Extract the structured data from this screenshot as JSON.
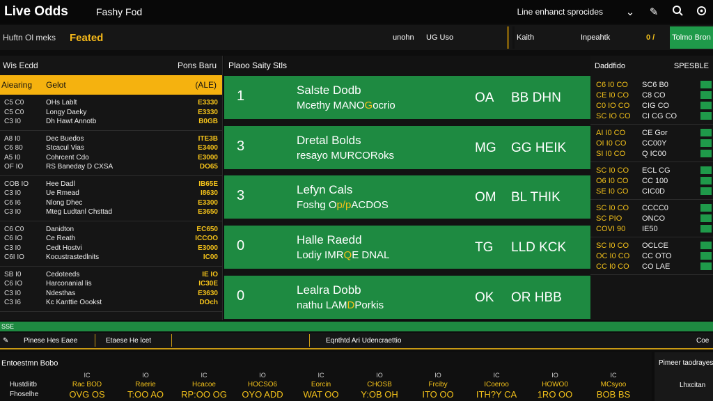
{
  "header": {
    "brand": "Live Odds",
    "subtitle": "Fashy Fod",
    "link": "Line enhanct sprocides",
    "icons": [
      "chevron-down-icon",
      "edit-icon",
      "search-icon",
      "globe-icon"
    ]
  },
  "subbar": {
    "label": "Huftn Ol meks",
    "accent": "Feated",
    "tabs": [
      "unohn",
      "UG Uso",
      "Kaith",
      "Inpeahtk"
    ],
    "badge": "0 /",
    "green_tab": "Tolmo Bron"
  },
  "left_panel": {
    "title": "Wis Ecdd",
    "title_right": "Pons Baru",
    "selected": {
      "col1": "Aiearing",
      "col2": "Gelot",
      "col3": "(ALE)"
    },
    "groups": [
      [
        {
          "time": "C5 C0",
          "name": "OHs Lablt",
          "odds": "E3330"
        },
        {
          "time": "C5 C0",
          "name": "Longy Daeky",
          "odds": "E3330"
        },
        {
          "time": "C3 I0",
          "name": "Dh Hawt Annotb",
          "odds": "B0GB"
        }
      ],
      [
        {
          "time": "A8 I0",
          "name": "Dec Buedos",
          "odds": "ITE3B"
        },
        {
          "time": "C6 80",
          "name": "Stcacul Vias",
          "odds": "E3400"
        },
        {
          "time": "A5 I0",
          "name": "Cohrcent Cdo",
          "odds": "E3000"
        },
        {
          "time": "OF IO",
          "name": "RS Baneday D CXSA",
          "odds": "DO65"
        }
      ],
      [
        {
          "time": "COB IO",
          "name": "Hee Dadl",
          "odds": "IB65E"
        },
        {
          "time": "C3 I0",
          "name": "Ue Rmead",
          "odds": "I8630"
        },
        {
          "time": "C6 I6",
          "name": "Nlong Dhec",
          "odds": "E3300"
        },
        {
          "time": "C3 I0",
          "name": "Mteg Ludtanl Chsttad",
          "odds": "E3650"
        }
      ],
      [
        {
          "time": "C6 C0",
          "name": "Danidton",
          "odds": "EC650"
        },
        {
          "time": "C6 IO",
          "name": "Ce Reath",
          "odds": "ICCOO"
        },
        {
          "time": "C3 I0",
          "name": "Cedt Hostvi",
          "odds": "E3000"
        },
        {
          "time": "C6I IO",
          "name": "Kocustrastedlnits",
          "odds": "IC00"
        }
      ],
      [
        {
          "time": "SB I0",
          "name": "Cedoteeds",
          "odds": "IE IO"
        },
        {
          "time": "C6 IO",
          "name": "Harconanial lis",
          "odds": "IC30E"
        },
        {
          "time": "C3 I0",
          "name": "Ndesthas",
          "odds": "E3630"
        },
        {
          "time": "C3 I6",
          "name": "Kc Kanttie Oookst",
          "odds": "DOch"
        }
      ]
    ]
  },
  "center_panel": {
    "title": "Plaoo Saity Stls",
    "cards": [
      {
        "num": "1",
        "title": "Salste Dodb",
        "sub_pre": "Mcethy MANO",
        "sub_hl": "G",
        "sub_post": "ocrio",
        "code": "OA",
        "code2": "BB DHN"
      },
      {
        "num": "3",
        "title": "Dretal Bolds",
        "sub_pre": "resayo MURCOR",
        "sub_hl": "",
        "sub_post": "oks",
        "code": "MG",
        "code2": "GG HEIK"
      },
      {
        "num": "3",
        "title": "Lefyn Cals",
        "sub_pre": "Foshg O",
        "sub_hl": "p/p",
        "sub_post": "ACDOS",
        "code": "OM",
        "code2": "BL THIK"
      },
      {
        "num": "0",
        "title": "Halle Raedd",
        "sub_pre": "Lodiy IMR",
        "sub_hl": "Q",
        "sub_post": "E DNAL",
        "code": "TG",
        "code2": "LLD KCK"
      },
      {
        "num": "0",
        "title": "Lealra Dobb",
        "sub_pre": "nathu LAM",
        "sub_hl": "D",
        "sub_post": "Porkis",
        "code": "OK",
        "code2": "OR HBB"
      }
    ]
  },
  "right_panel": {
    "title": "Daddfido",
    "title_right": "SPESBLE",
    "groups": [
      [
        {
          "a": "C6 I0 CO",
          "b": "SC6 B0"
        },
        {
          "a": "CE I0 CO",
          "b": "C8 CO"
        },
        {
          "a": "C0 IO CO",
          "b": "CIG CO"
        },
        {
          "a": "SC IO CO",
          "b": "CI CG CO"
        }
      ],
      [
        {
          "a": "AI I0 CO",
          "b": "CE Gor"
        },
        {
          "a": "OI I0 CO",
          "b": "CC00Y"
        },
        {
          "a": "SI I0 CO",
          "b": "Q IC00"
        }
      ],
      [
        {
          "a": "SC I0 CO",
          "b": "ECL CG"
        },
        {
          "a": "O6 I0 CO",
          "b": "CC 100"
        },
        {
          "a": "SE I0 CO",
          "b": "CIC0D"
        }
      ],
      [
        {
          "a": "SC I0 CO",
          "b": "CCCC0"
        },
        {
          "a": "SC PIO",
          "b": "ONCO"
        },
        {
          "a": "COVI 90",
          "b": "IE50"
        }
      ],
      [
        {
          "a": "SC I0 CO",
          "b": "OCLCE"
        },
        {
          "a": "OC I0 CO",
          "b": "CC OTO"
        },
        {
          "a": "CC I0 CO",
          "b": "CO LAE"
        }
      ]
    ]
  },
  "divider_text": "SSE",
  "toolbar": {
    "items": [
      "Pinese Hes Eaee",
      "Etaese He lcet",
      "Eqnthtd Ari Udencraettio",
      "Coe"
    ]
  },
  "stats": {
    "title": "Entoestmn Bobo",
    "row_labels": [
      "Hustdiitb",
      "Fhoselhe"
    ],
    "columns": [
      {
        "h": "IC",
        "m": "Rac BOD",
        "v": "OVG OS"
      },
      {
        "h": "IO",
        "m": "Raerie",
        "v": "T:OO AO"
      },
      {
        "h": "IC",
        "m": "Hcacoe",
        "v": "RP:OO OG"
      },
      {
        "h": "IO",
        "m": "HOCSO6",
        "v": "OYO ADD"
      },
      {
        "h": "IC",
        "m": "Eorcin",
        "v": "WAT OO"
      },
      {
        "h": "IO",
        "m": "CHOSB",
        "v": "Y:OB OH"
      },
      {
        "h": "IO",
        "m": "Frciby",
        "v": "ITO OO"
      },
      {
        "h": "IC",
        "m": "ICoeroo",
        "v": "ITH?Y CA"
      },
      {
        "h": "IO",
        "m": "HOWO0",
        "v": "1RO OO"
      },
      {
        "h": "IC",
        "m": "MCsyoo",
        "v": "BOB BS"
      }
    ],
    "side_title": "Pimeer taodrayes",
    "side_sub": "Lhxcitan"
  },
  "colors": {
    "accent_yellow": "#f5b20f",
    "card_green": "#1e8a41",
    "background": "#0d0d0d"
  }
}
